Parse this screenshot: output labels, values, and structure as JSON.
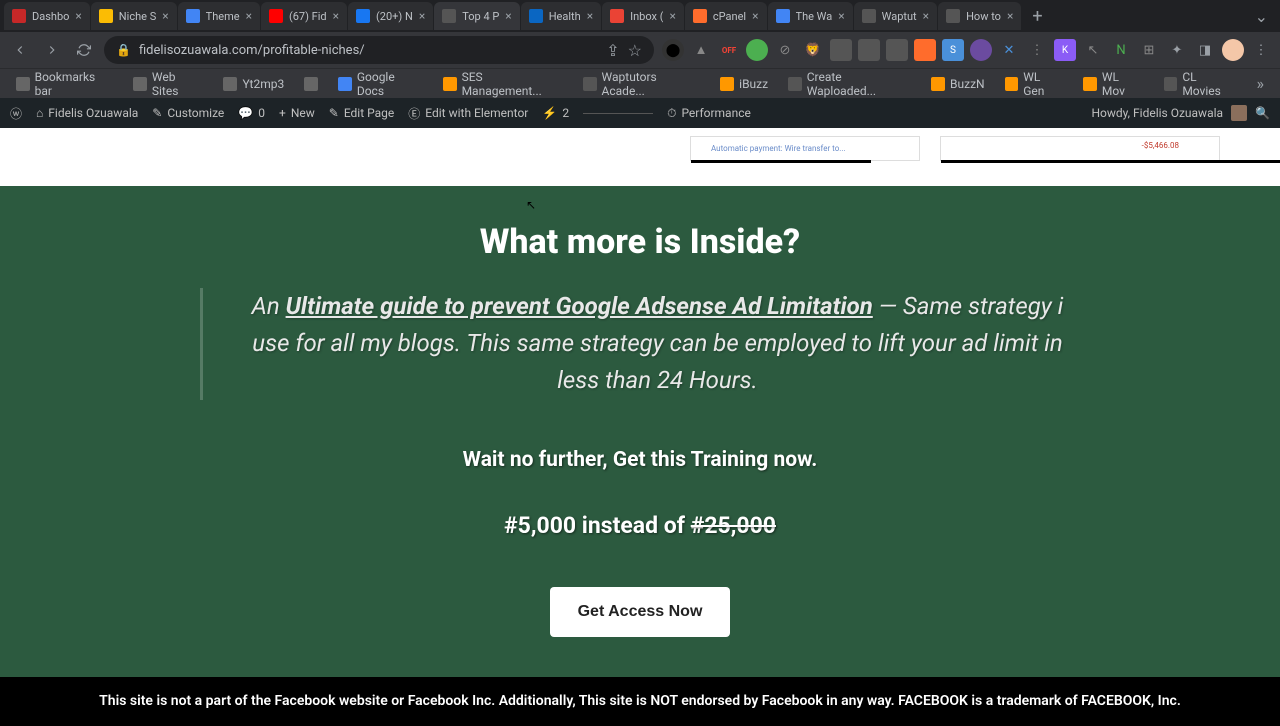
{
  "tabs": [
    {
      "title": "Dashbo",
      "favicon": "#c62828"
    },
    {
      "title": "Niche S",
      "favicon": "#fbbc04"
    },
    {
      "title": "Theme",
      "favicon": "#4285f4"
    },
    {
      "title": "(67) Fid",
      "favicon": "#ff0000"
    },
    {
      "title": "(20+) N",
      "favicon": "#1877f2"
    },
    {
      "title": "Top 4 P",
      "favicon": "#555",
      "active": true
    },
    {
      "title": "Health",
      "favicon": "#0a66c2"
    },
    {
      "title": "Inbox (",
      "favicon": "#ea4335"
    },
    {
      "title": "cPanel",
      "favicon": "#ff6c2c"
    },
    {
      "title": "The Wa",
      "favicon": "#4285f4"
    },
    {
      "title": "Waptut",
      "favicon": "#555"
    },
    {
      "title": "How to",
      "favicon": "#555"
    }
  ],
  "url": "fidelisozuawala.com/profitable-niches/",
  "bookmarks": [
    {
      "label": "Bookmarks bar",
      "icon": "#666"
    },
    {
      "label": "Web Sites",
      "icon": "#666"
    },
    {
      "label": "Yt2mp3",
      "icon": "#666"
    },
    {
      "label": "",
      "icon": "#666"
    },
    {
      "label": "Google Docs",
      "icon": "#4285f4"
    },
    {
      "label": "SES Management...",
      "icon": "#ff9800"
    },
    {
      "label": "Waptutors Acade...",
      "icon": "#555"
    },
    {
      "label": "iBuzz",
      "icon": "#ff9800"
    },
    {
      "label": "Create Waploaded...",
      "icon": "#555"
    },
    {
      "label": "BuzzN",
      "icon": "#ff9800"
    },
    {
      "label": "WL Gen",
      "icon": "#ff9800"
    },
    {
      "label": "WL Mov",
      "icon": "#ff9800"
    },
    {
      "label": "CL Movies",
      "icon": "#555"
    }
  ],
  "wpbar": {
    "site": "Fidelis Ozuawala",
    "customize": "Customize",
    "comments": "0",
    "new": "New",
    "edit": "Edit Page",
    "elementor": "Edit with Elementor",
    "cache": "2",
    "performance": "Performance",
    "howdy": "Howdy, Fidelis Ozuawala"
  },
  "band": {
    "transfer": "Automatic payment: Wire transfer to...",
    "balance": "-$5,466.08"
  },
  "content": {
    "heading": "What more is Inside?",
    "desc_prefix": "An ",
    "desc_link": "Ultimate guide to prevent Google Adsense Ad Limitation",
    "desc_suffix": " — Same strategy i use for all my blogs. This same strategy can be employed to lift your ad limit in less than 24 Hours.",
    "cta_text": "Wait no further, Get this Training now.",
    "price_current": "#5,000 instead of ",
    "price_old": "#25,000",
    "button": "Get Access Now"
  },
  "footer": "This site is not a part of the Facebook website or Facebook  Inc. Additionally, This site is NOT endorsed by Facebook in any way. FACEBOOK is a trademark of FACEBOOK, Inc."
}
